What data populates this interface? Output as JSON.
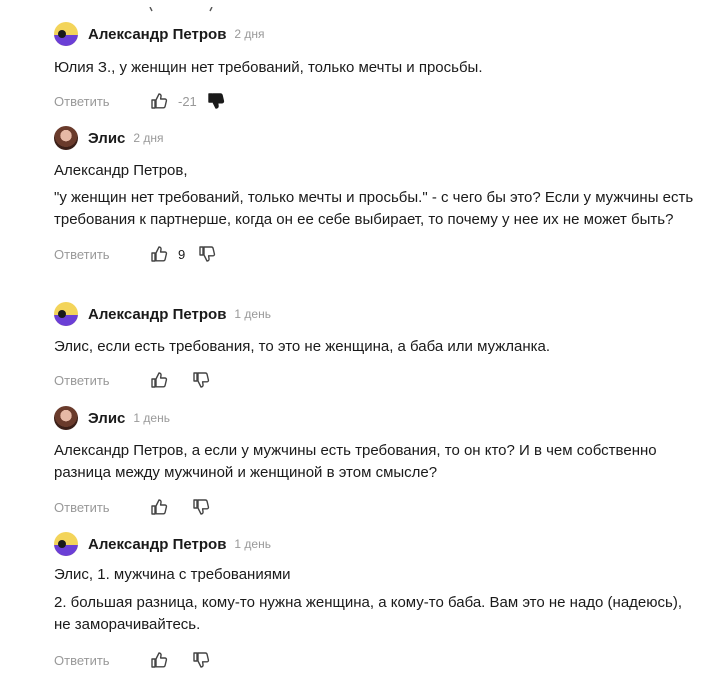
{
  "comments": [
    {
      "author": "Александр Петров",
      "date": "2 дня",
      "paragraphs": [
        "Юлия З., у женщин нет требований, только мечты и просьбы."
      ],
      "reply_label": "Ответить",
      "score": "-21",
      "disliked": true
    },
    {
      "author": "Элис",
      "date": "2 дня",
      "paragraphs": [
        "Александр Петров,",
        "\"у женщин нет требований, только мечты и просьбы.\" - с чего бы это? Если у мужчины есть требования к партнерше, когда он ее себе выбирает, то почему у нее их не может быть?"
      ],
      "reply_label": "Ответить",
      "score": "9",
      "disliked": false
    },
    {
      "author": "Александр Петров",
      "date": "1 день",
      "paragraphs": [
        "Элис, если есть требования, то это не женщина, а баба или мужланка."
      ],
      "reply_label": "Ответить",
      "score": "",
      "disliked": false
    },
    {
      "author": "Элис",
      "date": "1 день",
      "paragraphs": [
        "Александр Петров, а если у мужчины есть требования, то он кто? И в чем собственно разница между мужчиной и женщиной в этом смысле?"
      ],
      "reply_label": "Ответить",
      "score": "",
      "disliked": false
    },
    {
      "author": "Александр Петров",
      "date": "1 день",
      "paragraphs": [
        "Элис, 1. мужчина с требованиями",
        "2. большая разница, кому-то нужна женщина, а кому-то баба. Вам это не надо (надеюсь), не заморачивайтесь."
      ],
      "reply_label": "Ответить",
      "score": "",
      "disliked": false
    }
  ],
  "colors": {
    "text": "#1a1a1a",
    "muted": "#999999",
    "avatar_yellow": "#f3d45a",
    "avatar_purple": "#6b3fd6"
  }
}
